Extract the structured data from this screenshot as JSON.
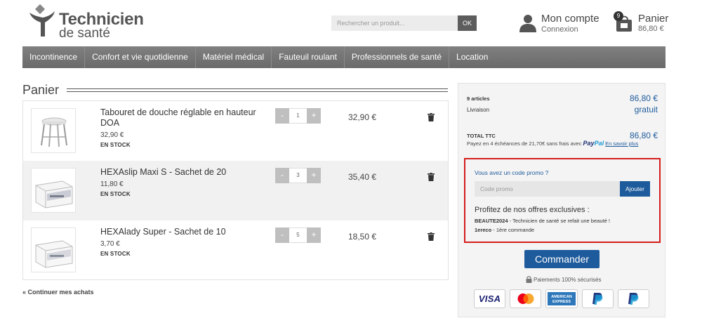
{
  "header": {
    "logo_line1": "Technicien",
    "logo_line2": "de santé",
    "search_placeholder": "Rechercher un produit...",
    "search_button": "OK",
    "account_title": "Mon compte",
    "account_sub": "Connexion",
    "cart_title": "Panier",
    "cart_total": "86,80 €",
    "cart_count": "9"
  },
  "nav": [
    "Incontinence",
    "Confort et vie quotidienne",
    "Matériel médical",
    "Fauteuil roulant",
    "Professionnels de santé",
    "Location"
  ],
  "page_title": "Panier",
  "items": [
    {
      "name": "Tabouret de douche réglable en hauteur DOA",
      "unit_price": "32,90 €",
      "stock": "EN STOCK",
      "qty": "1",
      "total": "32,90 €",
      "image": "shower-stool"
    },
    {
      "name": "HEXAslip Maxi S - Sachet de 20",
      "unit_price": "11,80 €",
      "stock": "EN STOCK",
      "qty": "3",
      "total": "35,40 €",
      "image": "product-box"
    },
    {
      "name": "HEXAlady Super - Sachet de 10",
      "unit_price": "3,70 €",
      "stock": "EN STOCK",
      "qty": "5",
      "total": "18,50 €",
      "image": "product-box"
    }
  ],
  "qty_minus": "-",
  "qty_plus": "+",
  "continue_label": "Continuer mes achats",
  "summary": {
    "articles_label": "9 articles",
    "articles_value": "86,80 €",
    "delivery_label": "Livraison",
    "delivery_value": "gratuit",
    "total_label": "TOTAL TTC",
    "total_value": "86,80 €",
    "paypal_text": "Payez en 4 échéances de 21,70€ sans frais avec",
    "paypal_logo_a": "Pay",
    "paypal_logo_b": "Pal",
    "paypal_link": "En savoir plus"
  },
  "promo": {
    "question": "Vous avez un code promo ?",
    "placeholder": "Code promo",
    "button": "Ajouter",
    "offers_title": "Profitez de nos offres exclusives :",
    "offer1_code": "BEAUTE2024",
    "offer1_text": " - Technicien de santé se refait une beauté !",
    "offer2_code": "1ereco",
    "offer2_text": " - 1ère commande"
  },
  "order_button": "Commander",
  "secure_text": "Paiements 100% sécurisés",
  "payment_methods": [
    "VISA",
    "mastercard",
    "AMERICAN EXPRESS",
    "paypal",
    "paypal"
  ],
  "colors": {
    "accent_blue": "#1e5b9c",
    "nav_gray": "#757575",
    "promo_border": "#d51c1c"
  }
}
